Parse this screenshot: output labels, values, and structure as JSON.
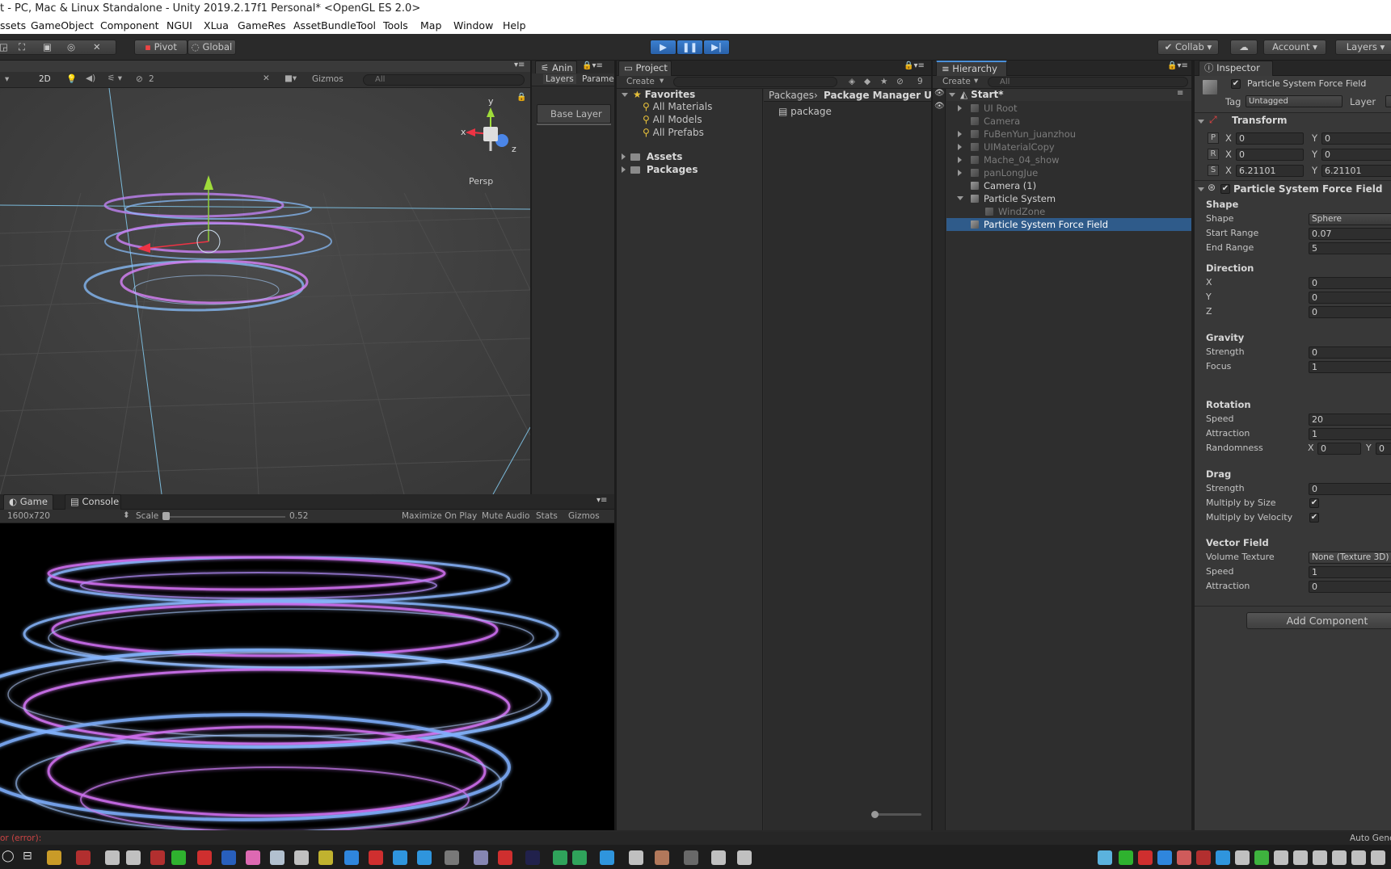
{
  "title": "t - PC, Mac & Linux Standalone - Unity 2019.2.17f1 Personal* <OpenGL ES 2.0>",
  "menu": [
    "ssets",
    "GameObject",
    "Component",
    "NGUI",
    "XLua",
    "GameRes",
    "AssetBundleTool",
    "Tools",
    "Map",
    "Window",
    "Help"
  ],
  "toolbar": {
    "pivot": "Pivot",
    "global": "Global",
    "collab": "Collab",
    "account": "Account",
    "layers": "Layers"
  },
  "scene": {
    "mode_2d": "2D",
    "hidden_count": "2",
    "gizmos": "Gizmos",
    "search_placeholder": "All",
    "persp": "Persp",
    "axis_x": "x",
    "axis_y": "y",
    "axis_z": "z"
  },
  "animator": {
    "tab": "Anin",
    "sub_layers": "Layers",
    "sub_params": "Parame",
    "base_layer": "Base Layer"
  },
  "game": {
    "tab_game": "Game",
    "tab_console": "Console",
    "resolution": "1600x720",
    "scale_label": "Scale",
    "scale_value": "0.52",
    "maximize": "Maximize On Play",
    "mute": "Mute Audio",
    "stats": "Stats",
    "gizmos": "Gizmos"
  },
  "project": {
    "tab": "Project",
    "create": "Create",
    "count": "9",
    "favorites": "Favorites",
    "fav_items": [
      "All Materials",
      "All Models",
      "All Prefabs"
    ],
    "roots": [
      "Assets",
      "Packages"
    ],
    "breadcrumb_root": "Packages",
    "breadcrumb_current": "Package Manager U",
    "files": [
      "package"
    ]
  },
  "hierarchy": {
    "tab": "Hierarchy",
    "create": "Create",
    "search_placeholder": "All",
    "scene": "Start*",
    "items": [
      {
        "label": "UI Root",
        "active": false,
        "expand": true
      },
      {
        "label": "Camera",
        "active": false,
        "expand": false
      },
      {
        "label": "FuBenYun_juanzhou",
        "active": false,
        "expand": true
      },
      {
        "label": "UIMaterialCopy",
        "active": false,
        "expand": true
      },
      {
        "label": "Mache_04_show",
        "active": false,
        "expand": true
      },
      {
        "label": "panLongJue",
        "active": false,
        "expand": true
      },
      {
        "label": "Camera (1)",
        "active": true,
        "expand": false
      },
      {
        "label": "Particle System",
        "active": true,
        "expand": "open"
      },
      {
        "label": "WindZone",
        "active": false,
        "expand": false
      },
      {
        "label": "Particle System Force Field",
        "active": true,
        "expand": false
      }
    ]
  },
  "inspector": {
    "tab": "Inspector",
    "object_name": "Particle System Force Field",
    "tag_label": "Tag",
    "tag_value": "Untagged",
    "layer_label": "Layer",
    "transform": {
      "title": "Transform",
      "rows": [
        {
          "key": "P",
          "x": "0",
          "y": "0"
        },
        {
          "key": "R",
          "x": "0",
          "y": "0"
        },
        {
          "key": "S",
          "x": "6.21101",
          "y": "6.21101"
        }
      ]
    },
    "component_title": "Particle System Force Field",
    "sections": [
      {
        "header": "Shape",
        "rows": [
          [
            "Shape",
            "Sphere"
          ],
          [
            "Start Range",
            "0.07"
          ],
          [
            "End Range",
            "5"
          ]
        ]
      },
      {
        "header": "Direction",
        "rows": [
          [
            "X",
            "0"
          ],
          [
            "Y",
            "0"
          ],
          [
            "Z",
            "0"
          ]
        ]
      },
      {
        "header": "Gravity",
        "rows": [
          [
            "Strength",
            "0"
          ],
          [
            "Focus",
            "1"
          ]
        ]
      },
      {
        "header": "Rotation",
        "rows": [
          [
            "Speed",
            "20"
          ],
          [
            "Attraction",
            "1"
          ],
          [
            "Randomness",
            ""
          ]
        ]
      },
      {
        "header": "Drag",
        "rows": [
          [
            "Strength",
            "0"
          ],
          [
            "Multiply by Size",
            "✔"
          ],
          [
            "Multiply by Velocity",
            "✔"
          ]
        ]
      },
      {
        "header": "Vector Field",
        "rows": [
          [
            "Volume Texture",
            "None (Texture 3D)"
          ],
          [
            "Speed",
            "1"
          ],
          [
            "Attraction",
            "0"
          ]
        ]
      }
    ],
    "randomness_x": "0",
    "randomness_y": "0",
    "add_component": "Add Component"
  },
  "status": {
    "error": "or (error):",
    "auto_gen": "Auto Gene"
  },
  "colors": {
    "accent": "#2c5d87",
    "play_blue": "#3d88d8",
    "selection": "#2f5b8a"
  }
}
